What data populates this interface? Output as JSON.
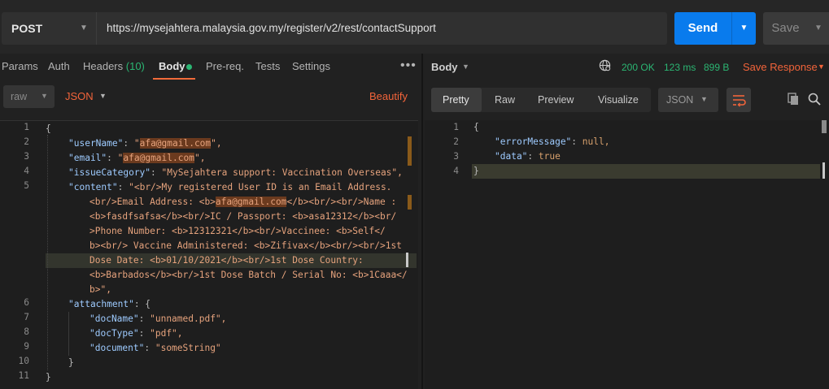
{
  "request": {
    "method": "POST",
    "url": "https://mysejahtera.malaysia.gov.my/register/v2/rest/contactSupport",
    "send_label": "Send",
    "save_label": "Save"
  },
  "request_tabs": {
    "params": "Params",
    "auth": "Auth",
    "headers": "Headers",
    "headers_count": "(10)",
    "body": "Body",
    "prereq": "Pre-req.",
    "tests": "Tests",
    "settings": "Settings"
  },
  "body_options": {
    "mode": "raw",
    "format": "JSON",
    "beautify": "Beautify"
  },
  "request_body": {
    "line_numbers": [
      "1",
      "2",
      "3",
      "4",
      "5",
      "",
      "",
      "",
      "",
      "",
      "",
      "",
      "6",
      "7",
      "8",
      "9",
      "10",
      "11"
    ],
    "open_brace": "{",
    "username_key": "\"userName\"",
    "username_q1": "\"",
    "username_val": "afa@gmail.com",
    "username_q2": "\",",
    "email_key": "\"email\"",
    "email_q1": "\"",
    "email_val": "afa@gmail.com",
    "email_q2": "\",",
    "issue_key": "\"issueCategory\"",
    "issue_val": "\"MySejahtera support: Vaccination Overseas\",",
    "content_key": "\"content\"",
    "content_line1": "\"<br/>My registered User ID is an Email Address.",
    "content_line2_a": "<br/>Email Address: <b>",
    "content_line2_hl": "afa@gmail.com",
    "content_line2_b": "</b><br/><br/>Name :",
    "content_line3": "<b>fasdfsafsa</b><br/>IC / Passport: <b>asa12312</b><br/",
    "content_line4": ">Phone Number: <b>12312321</b><br/>Vaccinee: <b>Self</",
    "content_line5": "b><br/> Vaccine Administered: <b>Zifivax</b><br/><br/>1st",
    "content_line6": "Dose Date: <b>01/10/2021</b><br/>1st Dose Country:",
    "content_line7": "<b>Barbados</b><br/>1st Dose Batch / Serial No: <b>1Caaa</",
    "content_line8": "b>\",",
    "attachment_key": "\"attachment\"",
    "attachment_open": ": {",
    "docname_key": "\"docName\"",
    "docname_val": "\"unnamed.pdf\",",
    "doctype_key": "\"docType\"",
    "doctype_val": "\"pdf\",",
    "document_key": "\"document\"",
    "document_val": "\"someString\"",
    "attachment_close": "}",
    "close_brace": "}"
  },
  "response": {
    "body_label": "Body",
    "status": "200 OK",
    "time": "123 ms",
    "size": "899 B",
    "save_response": "Save Response",
    "view_tabs": [
      "Pretty",
      "Raw",
      "Preview",
      "Visualize"
    ],
    "format": "JSON",
    "line_numbers": [
      "1",
      "2",
      "3",
      "4"
    ],
    "open_brace": "{",
    "error_key": "\"errorMessage\"",
    "error_val": "null,",
    "data_key": "\"data\"",
    "data_val": "true",
    "close_brace": "}"
  },
  "colors": {
    "accent": "#f2643a",
    "send": "#097bed",
    "success": "#2bb673"
  }
}
